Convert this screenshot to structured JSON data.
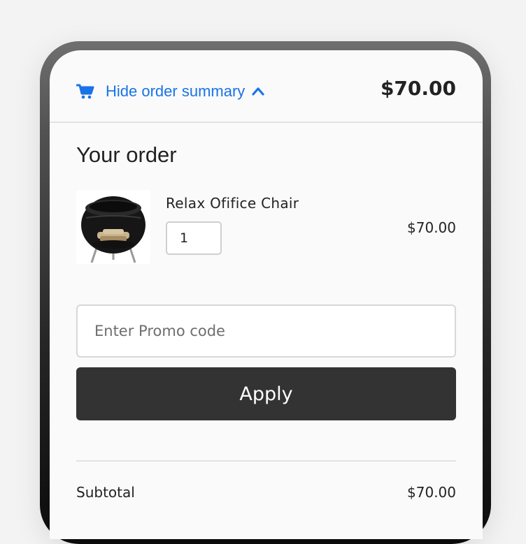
{
  "order_summary": {
    "toggle_label": "Hide order summary",
    "total": "$70.00",
    "icon_color": "#1a73e8"
  },
  "order": {
    "heading": "Your order",
    "items": [
      {
        "name": "Relax Ofifice Chair",
        "quantity": "1",
        "price": "$70.00",
        "thumbnail_icon": "fire-pit-chair-image"
      }
    ]
  },
  "promo": {
    "placeholder": "Enter Promo code",
    "value": "",
    "apply_label": "Apply"
  },
  "totals": {
    "subtotal_label": "Subtotal",
    "subtotal_value": "$70.00"
  }
}
